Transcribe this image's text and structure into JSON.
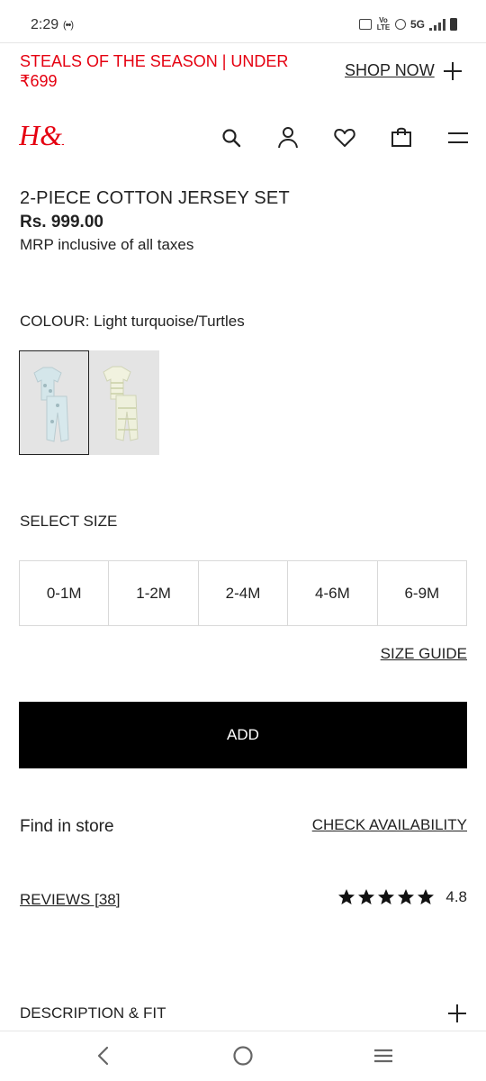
{
  "status": {
    "time": "2:29",
    "radio": "(••)",
    "volte": "Vo LTE",
    "network": "5G"
  },
  "promo": {
    "text": "STEALS OF THE SEASON | UNDER ₹699",
    "cta": "SHOP NOW",
    "accent": "#e50010"
  },
  "header": {
    "logo": "H&M",
    "icons": [
      "search-icon",
      "account-icon",
      "heart-icon",
      "bag-icon",
      "menu-icon"
    ]
  },
  "product": {
    "title": "2-PIECE COTTON JERSEY SET",
    "price": "Rs. 999.00",
    "tax_note": "MRP inclusive of all taxes",
    "colour_label": "COLOUR: Light turquoise/Turtles",
    "swatches": [
      {
        "name": "Light turquoise/Turtles",
        "selected": true,
        "color": "#d6e6ea"
      },
      {
        "name": "Light green striped",
        "selected": false,
        "color": "#eef0dc"
      }
    ]
  },
  "sizes": {
    "label": "SELECT SIZE",
    "options": [
      "0-1M",
      "1-2M",
      "2-4M",
      "4-6M",
      "6-9M"
    ],
    "guide": "SIZE GUIDE"
  },
  "actions": {
    "add": "ADD",
    "find_store": "Find in store",
    "check_availability": "CHECK AVAILABILITY"
  },
  "reviews": {
    "label": "REVIEWS [38]",
    "rating": "4.8",
    "stars": 5
  },
  "description": {
    "label": "DESCRIPTION & FIT"
  },
  "nav": [
    "back-icon",
    "home-icon",
    "recents-icon"
  ]
}
